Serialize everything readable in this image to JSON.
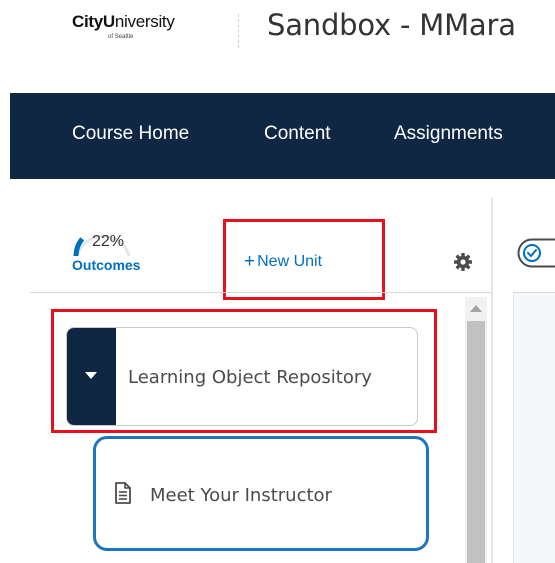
{
  "brand": {
    "logo_bold": "City",
    "logo_u": "U",
    "logo_rest": "niversity",
    "logo_sub": "of Seattle",
    "course_title": "Sandbox - MMara"
  },
  "navbar": {
    "items": [
      {
        "label": "Course Home"
      },
      {
        "label": "Content"
      },
      {
        "label": "Assignments"
      }
    ]
  },
  "sidebar": {
    "progress": {
      "percent_label": "22%",
      "percent_value": 22,
      "label": "Outcomes"
    },
    "new_unit": {
      "plus": "+",
      "label": "New Unit"
    },
    "settings_icon": "gear-icon",
    "unit": {
      "title": "Learning Object Repository",
      "expand_icon": "caret-down-icon"
    },
    "topic": {
      "icon": "document-icon",
      "title": "Meet Your Instructor"
    }
  },
  "colors": {
    "navbar_bg": "#0f2742",
    "link_blue": "#006fbf",
    "highlight_red": "#e8101c",
    "highlight_blue": "#1f74c2"
  }
}
